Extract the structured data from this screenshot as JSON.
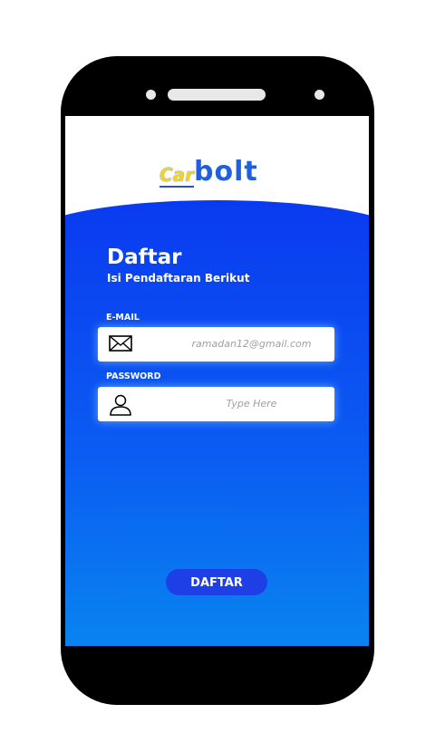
{
  "logo": {
    "part1": "Car",
    "part2": "bolt"
  },
  "header": {
    "title": "Daftar",
    "subtitle": "Isi Pendaftaran Berikut"
  },
  "form": {
    "email": {
      "label": "E-MAIL",
      "value": "ramadan12@gmail.com",
      "icon": "envelope-icon"
    },
    "password": {
      "label": "PASSWORD",
      "placeholder": "Type Here",
      "icon": "user-icon"
    }
  },
  "submit_label": "DAFTAR",
  "colors": {
    "primary": "#1e3fe6",
    "gradient_top": "#0a3af0",
    "gradient_bottom": "#0891ee"
  }
}
